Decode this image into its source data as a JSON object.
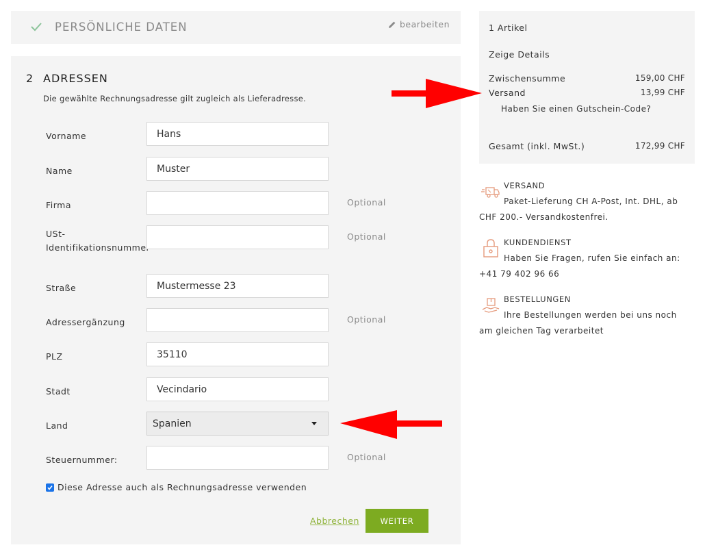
{
  "personal": {
    "title": "PERSÖNLICHE DATEN",
    "edit_label": "bearbeiten"
  },
  "address": {
    "step_number": "2",
    "title": "ADRESSEN",
    "description": "Die gewählte Rechnungsadresse gilt zugleich als Lieferadresse.",
    "fields": {
      "vorname": {
        "label": "Vorname",
        "value": "Hans"
      },
      "name": {
        "label": "Name",
        "value": "Muster"
      },
      "firma": {
        "label": "Firma",
        "value": "",
        "optional": "Optional"
      },
      "ust": {
        "label": "USt-Identifikationsnummer",
        "value": "",
        "optional": "Optional"
      },
      "strasse": {
        "label": "Straße",
        "value": "Mustermesse 23"
      },
      "zusatz": {
        "label": "Adressergänzung",
        "value": "",
        "optional": "Optional"
      },
      "plz": {
        "label": "PLZ",
        "value": "35110"
      },
      "stadt": {
        "label": "Stadt",
        "value": "Vecindario"
      },
      "land": {
        "label": "Land",
        "value": "Spanien"
      },
      "steuer": {
        "label": "Steuernummer:",
        "value": "",
        "optional": "Optional"
      }
    },
    "billing_checkbox": {
      "label": "Diese Adresse auch als Rechnungsadresse verwenden",
      "checked": true
    },
    "cancel_label": "Abbrechen",
    "next_label": "WEITER"
  },
  "summary": {
    "items_count": "1 Artikel",
    "details_label": "Zeige Details",
    "subtotal_label": "Zwischensumme",
    "subtotal_value": "159,00 CHF",
    "shipping_label": "Versand",
    "shipping_value": "13,99 CHF",
    "coupon_label": "Haben Sie einen Gutschein-Code?",
    "total_label": "Gesamt (inkl. MwSt.)",
    "total_value": "172,99 CHF"
  },
  "info": {
    "shipping": {
      "title": "VERSAND",
      "line1": "Paket-Lieferung CH A-Post, Int. DHL, ab",
      "line2": "CHF 200.- Versandkostenfrei."
    },
    "support": {
      "title": "KUNDENDIENST",
      "line1": "Haben Sie Fragen, rufen Sie einfach an:",
      "line2": "+41 79 402 96 66"
    },
    "orders": {
      "title": "BESTELLUNGEN",
      "line1": "Ihre Bestellungen werden bei uns noch",
      "line2": "am gleichen Tag verarbeitet"
    }
  },
  "colors": {
    "accent_green": "#7dab21",
    "check_green": "#8cc49a",
    "icon_orange": "#e59a7c",
    "annotation_red": "#ff0000"
  }
}
